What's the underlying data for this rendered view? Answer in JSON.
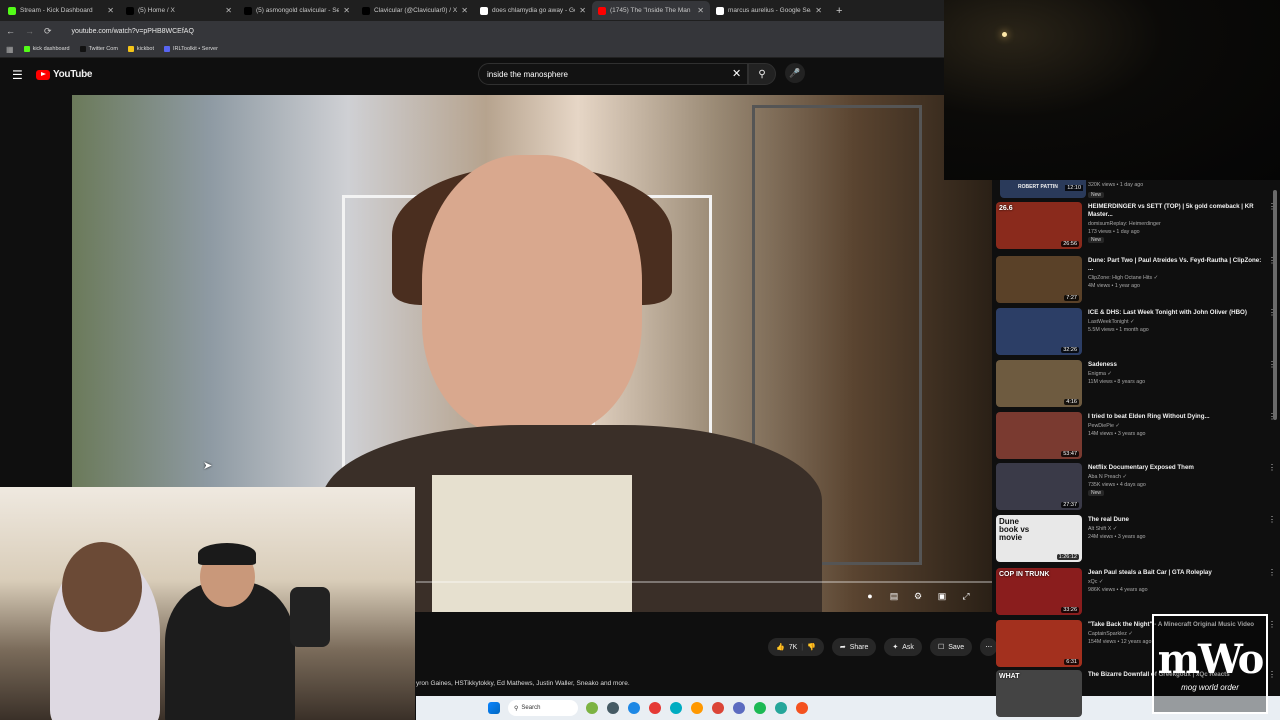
{
  "browser": {
    "tabs": [
      {
        "title": "Stream - Kick Dashboard",
        "color": "#53fc18"
      },
      {
        "title": "(5) Home / X",
        "color": "#000000"
      },
      {
        "title": "(5) asmongold clavicular - Sear",
        "color": "#000000"
      },
      {
        "title": "Clavicular (@Clavicular0) / X",
        "color": "#000000"
      },
      {
        "title": "does chlamydia go away - Goo",
        "color": "#ffffff"
      },
      {
        "title": "(1745) The \"Inside The Man",
        "color": "#ff0000"
      },
      {
        "title": "marcus aurelius - Google Searc",
        "color": "#ffffff"
      }
    ],
    "active_tab_index": 5,
    "url": "youtube.com/watch?v=pPHB8WCEfAQ",
    "bookmarks": [
      {
        "label": "kick dashboard",
        "color": "#53fc18"
      },
      {
        "label": "Twitter Com",
        "color": "#111111"
      },
      {
        "label": "kickbot",
        "color": "#f5c518"
      },
      {
        "label": "IRLToolkit • Server",
        "color": "#5865f2"
      }
    ]
  },
  "youtube": {
    "logo": "YouTube",
    "search_value": "inside the manosphere",
    "actions": {
      "likes": "7K",
      "share": "Share",
      "ask": "Ask",
      "save": "Save",
      "more": "⋯"
    },
    "description": "yron Gaines, HSTikkytokky, Ed Mathews, Justin Waller, Sneako and more."
  },
  "recommendations": {
    "top_partial_meta": "320K views • 1 day ago",
    "top_partial_new": "New",
    "top_partial_thumb_text": "ROBERT PATTIN",
    "top_partial_duration": "12:10",
    "items": [
      {
        "title": "HEIMERDINGER vs SETT (TOP) | 5k gold comeback | KR Master...",
        "channel": "domisumReplay: Heimerdinger",
        "meta": "173 views • 1 day ago",
        "new": "New",
        "duration": "26:56",
        "overlay": "26.6",
        "thumb": "#8a2a1c"
      },
      {
        "title": "Dune: Part Two | Paul Atreides Vs. Feyd-Rautha | ClipZone: ...",
        "channel": "ClipZone: High Octane Hits ✓",
        "meta": "4M views • 1 year ago",
        "new": "",
        "duration": "7:27",
        "overlay": "",
        "thumb": "#5a4128"
      },
      {
        "title": "ICE & DHS: Last Week Tonight with John Oliver (HBO)",
        "channel": "LastWeekTonight ✓",
        "meta": "5.5M views • 1 month ago",
        "new": "",
        "duration": "32:26",
        "overlay": "",
        "thumb": "#2c3e66"
      },
      {
        "title": "Sadeness",
        "channel": "Enigma ✓",
        "meta": "11M views • 8 years ago",
        "new": "",
        "duration": "4:16",
        "overlay": "",
        "thumb": "#6e5b40"
      },
      {
        "title": "I tried to beat Elden Ring Without Dying...",
        "channel": "PewDiePie ✓",
        "meta": "14M views • 3 years ago",
        "new": "",
        "duration": "53:47",
        "overlay": "",
        "thumb": "#7a3a30"
      },
      {
        "title": "Netflix Documentary Exposed Them",
        "channel": "Aba N Preach ✓",
        "meta": "735K views • 4 days ago",
        "new": "New",
        "duration": "27:37",
        "overlay": "",
        "thumb": "#3a3a48"
      },
      {
        "title": "The real Dune",
        "channel": "Alt Shift X ✓",
        "meta": "24M views • 3 years ago",
        "new": "",
        "duration": "1:26:12",
        "overlay": "Dune book vs movie",
        "thumb": "#e8e8e8"
      },
      {
        "title": "Jean Paul steals a Bait Car | GTA Roleplay",
        "channel": "xQc ✓",
        "meta": "986K views • 4 years ago",
        "new": "",
        "duration": "33:26",
        "overlay": "COP IN TRUNK",
        "thumb": "#8a1d1d"
      },
      {
        "title": "\"Take Back the Night\" - A Minecraft Original Music Video",
        "channel": "CaptainSparklez ✓",
        "meta": "154M views • 12 years ago",
        "new": "",
        "duration": "6:31",
        "overlay": "",
        "thumb": "#a3301e"
      },
      {
        "title": "The Bizarre Downfall of Greekgodx | xQc Reacts",
        "channel": "",
        "meta": "",
        "new": "",
        "duration": "",
        "overlay": "WHAT",
        "thumb": "#444444"
      }
    ]
  },
  "taskbar": {
    "search_placeholder": "Search",
    "icon_colors": [
      "#7cb342",
      "#455a64",
      "#1e88e5",
      "#e53935",
      "#00acc1",
      "#ff9800",
      "#db4437",
      "#5c6bc0",
      "#1db954",
      "#26a69a",
      "#f4511e"
    ]
  },
  "overlay": {
    "logo_big": "mWo",
    "logo_small": "mog world order"
  }
}
